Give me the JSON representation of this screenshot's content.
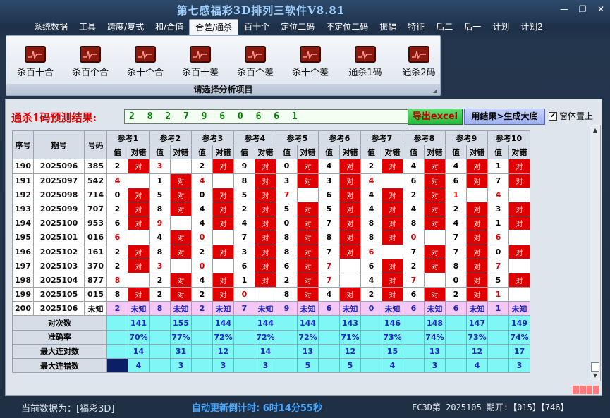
{
  "app": {
    "title": "第七感福彩3D排列三软件V8.81",
    "window_buttons": [
      "—",
      "❐",
      "✕"
    ]
  },
  "menu": [
    "系统数据",
    "工具",
    "跨度/复式",
    "和/合值",
    "合差/通杀",
    "百十个",
    "定位二码",
    "不定位二码",
    "振幅",
    "特征",
    "后二",
    "后一",
    "计划",
    "计划2"
  ],
  "menu_active": 4,
  "ribbon": {
    "tools": [
      "杀百十合",
      "杀百个合",
      "杀十个合",
      "杀百十差",
      "杀百个差",
      "杀十个差",
      "通杀1码",
      "通杀2码"
    ],
    "caption": "请选择分析项目"
  },
  "prediction": {
    "label": "通杀1码预测结果:",
    "value": "2 8 2 7 9 6 0 6 6 1",
    "export_button": "导出excel",
    "generate_button": "用结果>生成大底",
    "topmost_label": "窗体置上",
    "topmost_checked": "✔"
  },
  "table": {
    "headers": {
      "index": "序号",
      "issue": "期号",
      "number": "号码",
      "value": "值",
      "result": "对错"
    },
    "refs": [
      "参考1",
      "参考2",
      "参考3",
      "参考4",
      "参考5",
      "参考6",
      "参考7",
      "参考8",
      "参考9",
      "参考10"
    ],
    "right_text": "对",
    "unknown_text": "未知",
    "rows": [
      {
        "idx": "190",
        "issue": "2025096",
        "num": "385",
        "v": [
          "2",
          "3",
          "2",
          "9",
          "0",
          "4",
          "2",
          "4",
          "4",
          "1"
        ],
        "r": [
          1,
          0,
          1,
          1,
          1,
          1,
          1,
          1,
          1,
          1
        ]
      },
      {
        "idx": "191",
        "issue": "2025097",
        "num": "542",
        "v": [
          "4",
          "1",
          "4",
          "8",
          "3",
          "3",
          "4",
          "6",
          "6",
          "7"
        ],
        "r": [
          0,
          1,
          0,
          1,
          1,
          1,
          0,
          1,
          1,
          1
        ]
      },
      {
        "idx": "192",
        "issue": "2025098",
        "num": "714",
        "v": [
          "0",
          "5",
          "0",
          "5",
          "7",
          "6",
          "4",
          "2",
          "1",
          "4"
        ],
        "r": [
          1,
          1,
          1,
          1,
          0,
          1,
          1,
          1,
          0,
          0
        ]
      },
      {
        "idx": "193",
        "issue": "2025099",
        "num": "707",
        "v": [
          "2",
          "8",
          "4",
          "2",
          "5",
          "5",
          "4",
          "4",
          "2",
          "3"
        ],
        "r": [
          1,
          1,
          1,
          1,
          1,
          1,
          1,
          1,
          1,
          1
        ]
      },
      {
        "idx": "194",
        "issue": "2025100",
        "num": "953",
        "v": [
          "6",
          "9",
          "4",
          "4",
          "0",
          "7",
          "8",
          "8",
          "4",
          "1"
        ],
        "r": [
          1,
          0,
          1,
          1,
          1,
          1,
          1,
          1,
          1,
          1
        ]
      },
      {
        "idx": "195",
        "issue": "2025101",
        "num": "016",
        "v": [
          "6",
          "4",
          "0",
          "7",
          "8",
          "8",
          "8",
          "0",
          "7",
          "6"
        ],
        "r": [
          0,
          1,
          0,
          1,
          1,
          1,
          1,
          0,
          1,
          0
        ]
      },
      {
        "idx": "196",
        "issue": "2025102",
        "num": "161",
        "v": [
          "2",
          "8",
          "2",
          "3",
          "8",
          "7",
          "6",
          "7",
          "7",
          "0"
        ],
        "r": [
          1,
          1,
          1,
          1,
          1,
          1,
          0,
          1,
          1,
          1
        ]
      },
      {
        "idx": "197",
        "issue": "2025103",
        "num": "370",
        "v": [
          "2",
          "3",
          "0",
          "6",
          "6",
          "7",
          "6",
          "2",
          "8",
          "7"
        ],
        "r": [
          1,
          0,
          0,
          1,
          1,
          0,
          1,
          1,
          1,
          0
        ]
      },
      {
        "idx": "198",
        "issue": "2025104",
        "num": "877",
        "v": [
          "8",
          "2",
          "4",
          "1",
          "2",
          "7",
          "4",
          "7",
          "0",
          "5"
        ],
        "r": [
          0,
          1,
          1,
          1,
          1,
          0,
          1,
          0,
          1,
          1
        ]
      },
      {
        "idx": "199",
        "issue": "2025105",
        "num": "015",
        "v": [
          "8",
          "2",
          "2",
          "0",
          "8",
          "4",
          "2",
          "6",
          "2",
          "1"
        ],
        "r": [
          1,
          1,
          1,
          0,
          1,
          1,
          1,
          1,
          1,
          0
        ]
      },
      {
        "idx": "200",
        "issue": "2025106",
        "num": "未知",
        "v": [
          "2",
          "8",
          "2",
          "7",
          "9",
          "6",
          "0",
          "6",
          "6",
          "1"
        ],
        "r": [
          2,
          2,
          2,
          2,
          2,
          2,
          2,
          2,
          2,
          2
        ]
      }
    ],
    "stats": [
      {
        "label": "对次数",
        "values": [
          "141",
          "155",
          "144",
          "144",
          "144",
          "143",
          "146",
          "148",
          "147",
          "149"
        ]
      },
      {
        "label": "准确率",
        "values": [
          "70%",
          "77%",
          "72%",
          "72%",
          "72%",
          "71%",
          "73%",
          "74%",
          "73%",
          "74%"
        ]
      },
      {
        "label": "最大连对数",
        "values": [
          "14",
          "31",
          "12",
          "14",
          "13",
          "12",
          "15",
          "13",
          "12",
          "17"
        ]
      },
      {
        "label": "最大连错数",
        "values": [
          "4",
          "3",
          "3",
          "3",
          "5",
          "5",
          "4",
          "3",
          "4",
          "3"
        ]
      }
    ]
  },
  "scrollbar": {
    "up": "▲",
    "down": "▼"
  },
  "status": {
    "current": "当前数据为：[福彩3D]",
    "countdown": "自动更新倒计时:  6时14分55秒",
    "issue": "FC3D第 2025105 期开:【015】【746】"
  }
}
